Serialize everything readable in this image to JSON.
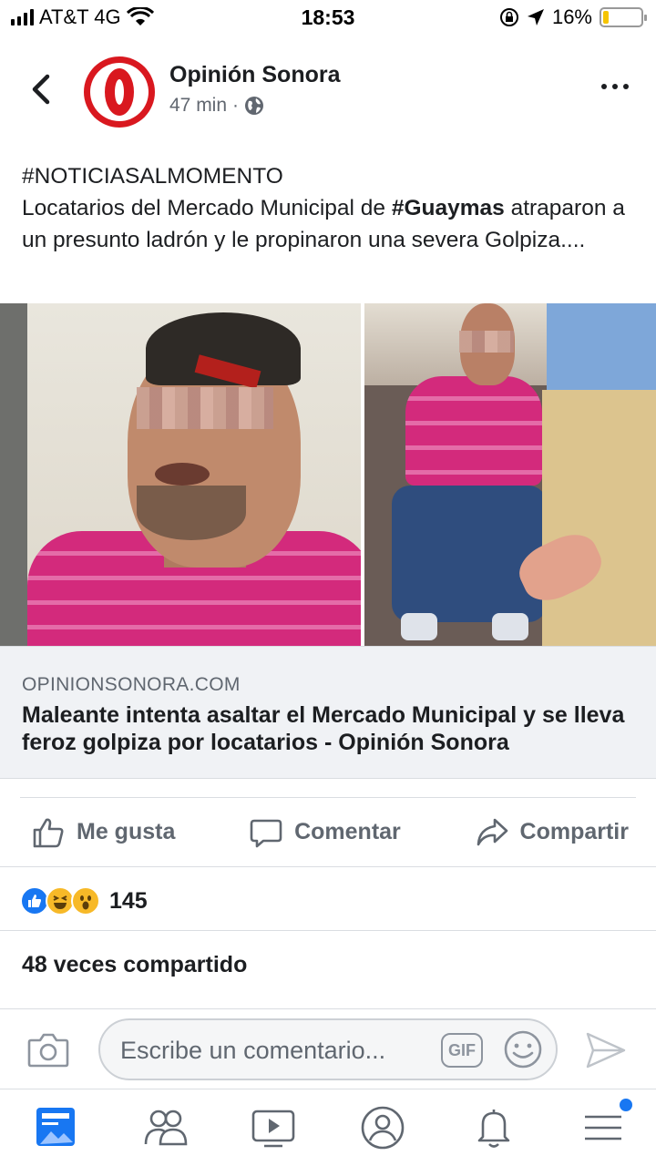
{
  "status_bar": {
    "carrier": "AT&T 4G",
    "time": "18:53",
    "battery": "16%",
    "battery_level": 0.16,
    "battery_color": "#f5c400"
  },
  "post": {
    "page_name": "Opinión Sonora",
    "time_ago": "47 min",
    "separator": "·",
    "privacy_icon": "globe-icon",
    "hashtag": "#NOTICIASALMOMENTO",
    "text_before": "Locatarios del Mercado Municipal de ",
    "text_hashtag": "#Guaymas",
    "text_after": " atraparon a un presunto ladrón y le propinaron una severa Golpiza...."
  },
  "link_preview": {
    "domain": "OPINIONSONORA.COM",
    "title": "Maleante intenta asaltar el Mercado Municipal y se lleva feroz golpiza por locatarios - Opinión Sonora"
  },
  "actions": {
    "like": "Me gusta",
    "comment": "Comentar",
    "share": "Compartir"
  },
  "reactions": {
    "count": "145",
    "types": [
      "like",
      "haha",
      "wow"
    ]
  },
  "shares": "48 veces compartido",
  "comment_bar": {
    "placeholder": "Escribe un comentario...",
    "gif_label": "GIF"
  },
  "bottom_nav": [
    "news-feed-icon",
    "friends-icon",
    "watch-icon",
    "profile-icon",
    "notifications-icon",
    "menu-icon"
  ],
  "colors": {
    "brand_blue": "#1877f2",
    "logo_red": "#d9181f",
    "text_gray": "#606770"
  }
}
